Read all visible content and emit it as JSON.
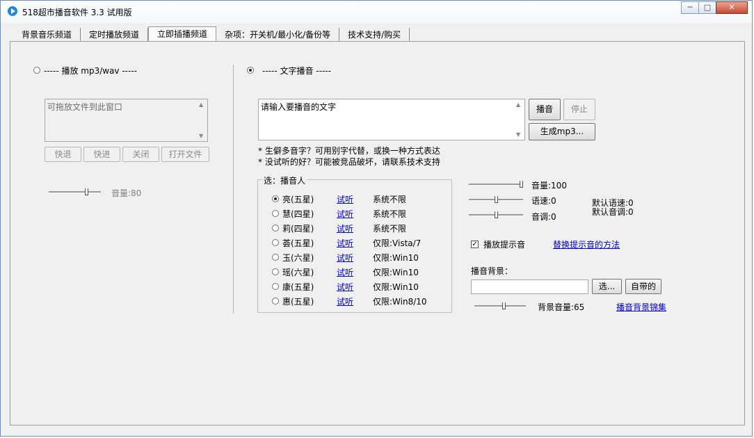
{
  "window": {
    "title": "518超市播音软件 3.3 试用版",
    "min": "─",
    "max": "□",
    "close": "✕"
  },
  "tabs": [
    "背景音乐频道",
    "定时播放频道",
    "立即插播频道",
    "杂项：开关机/最小化/备份等",
    "技术支持/购买"
  ],
  "left": {
    "radio_label": "----- 播放 mp3/wav -----",
    "drop_placeholder": "可拖放文件到此窗口",
    "buttons": {
      "rewind": "快退",
      "forward": "快进",
      "close": "关闭",
      "open": "打开文件"
    },
    "volume": "音量:80",
    "volume_level": 0.8
  },
  "right": {
    "radio_label": "----- 文字播音 -----",
    "text": "请输入要播音的文字",
    "buttons": {
      "play": "播音",
      "stop": "停止",
      "gen": "生成mp3..."
    },
    "note1": "* 生僻多音字？可用别字代替，或换一种方式表达",
    "note2": "* 没试听的好？可能被竞品破坏，请联系技术支持",
    "group_title": "选：播音人",
    "listen": "试听",
    "voices": [
      {
        "name": "亮(五星)",
        "limit": "系统不限",
        "selected": true
      },
      {
        "name": "慧(四星)",
        "limit": "系统不限"
      },
      {
        "name": "莉(四星)",
        "limit": "系统不限"
      },
      {
        "name": "荟(五星)",
        "limit": "仅限:Vista/7"
      },
      {
        "name": "玉(六星)",
        "limit": "仅限:Win10"
      },
      {
        "name": "瑶(六星)",
        "limit": "仅限:Win10"
      },
      {
        "name": "康(五星)",
        "limit": "仅限:Win10"
      },
      {
        "name": "惠(五星)",
        "limit": "仅限:Win8/10"
      }
    ],
    "volume": "音量:100",
    "speed": "语速:0",
    "pitch": "音调:0",
    "default_speed": "默认语速:0",
    "default_pitch": "默认音调:0",
    "prompt_check": "播放提示音",
    "prompt_check_mark": "✓",
    "prompt_link": "替换提示音的方法",
    "bg_label": "播音背景：",
    "bg_choose": "选...",
    "bg_builtin": "自带的",
    "bg_volume": "背景音量:65",
    "bg_link": "播音背景锦集"
  }
}
